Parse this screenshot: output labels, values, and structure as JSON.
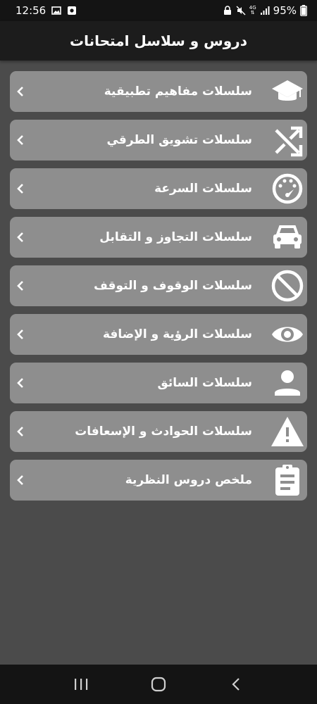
{
  "status_bar": {
    "time": "12:56",
    "network_type": "4G",
    "battery": "95%"
  },
  "header": {
    "title": "دروس و سلاسل امتحانات"
  },
  "menu": {
    "items": [
      {
        "label": "سلسلات مفاهيم تطبيقية",
        "icon": "graduation-cap-icon"
      },
      {
        "label": "سلسلات تشويق الطرقي",
        "icon": "shuffle-icon"
      },
      {
        "label": "سلسلات السرعة",
        "icon": "speedometer-icon"
      },
      {
        "label": "سلسلات التجاوز و التقابل",
        "icon": "car-icon"
      },
      {
        "label": "سلسلات الوقوف و التوقف",
        "icon": "block-icon"
      },
      {
        "label": "سلسلات الرؤية و الإضافة",
        "icon": "eye-icon"
      },
      {
        "label": "سلسلات السائق",
        "icon": "person-icon"
      },
      {
        "label": "سلسلات الحوادث و الإسعافات",
        "icon": "warning-icon"
      },
      {
        "label": "ملخص دروس النظرية",
        "icon": "clipboard-icon"
      }
    ]
  },
  "colors": {
    "background": "#4b4b4b",
    "header": "#1c1c1c",
    "item": "#8e8e8e"
  }
}
